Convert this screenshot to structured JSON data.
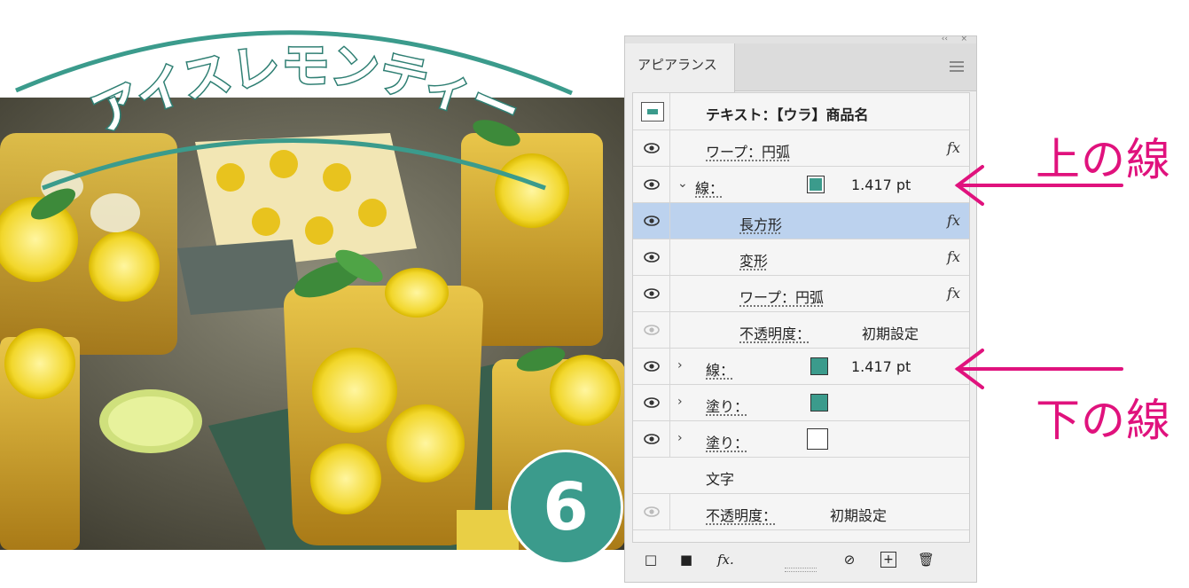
{
  "artwork": {
    "title": "アイスレモンティー",
    "step_number": "6"
  },
  "panel": {
    "tab_label": "アピアランス",
    "rows": [
      {
        "id": "object",
        "label": "テキスト：【ウラ】商品名",
        "type": "object"
      },
      {
        "id": "warp1",
        "label": "ワープ：円弧",
        "fx": "fx"
      },
      {
        "id": "stroke-upper",
        "label": "線：",
        "value": "1.417 pt",
        "caret": "⌄",
        "swatch": "outlined"
      },
      {
        "id": "rect",
        "label": "長方形",
        "fx": "fx",
        "selected": true
      },
      {
        "id": "transform",
        "label": "変形",
        "fx": "fx"
      },
      {
        "id": "warp2",
        "label": "ワープ：円弧",
        "fx": "fx"
      },
      {
        "id": "opacity1",
        "label": "不透明度：",
        "value": "初期設定"
      },
      {
        "id": "stroke-lower",
        "label": "線：",
        "value": "1.417 pt",
        "caret": "›",
        "swatch": "filled"
      },
      {
        "id": "fill1",
        "label": "塗り：",
        "caret": "›",
        "swatch": "filled"
      },
      {
        "id": "fill2",
        "label": "塗り：",
        "caret": "›",
        "swatch": "none"
      },
      {
        "id": "characters",
        "label": "文字"
      },
      {
        "id": "opacity2",
        "label": "不透明度：",
        "value": "初期設定"
      }
    ],
    "bottom_tools": [
      "□",
      "■",
      "fx.",
      "⊘",
      "+",
      "🗑"
    ]
  },
  "annotations": {
    "upper": "上の線",
    "lower": "下の線"
  },
  "colors": {
    "teal": "#3b9b8c",
    "magenta": "#e0127d",
    "selection": "#bcd2ee"
  }
}
